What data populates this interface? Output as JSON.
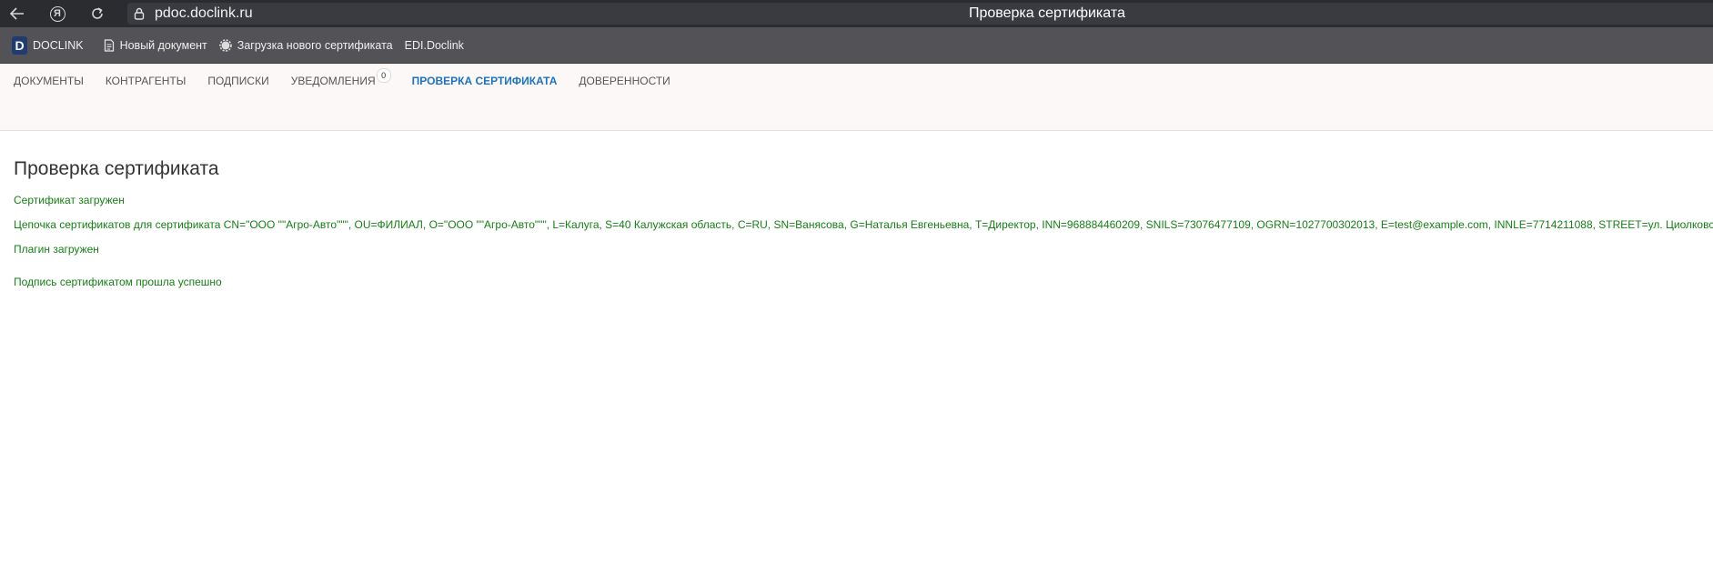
{
  "browser": {
    "url": "pdoc.doclink.ru",
    "page_title": "Проверка сертификата",
    "icons": [
      "back-arrow-icon",
      "yandex-icon",
      "reload-icon",
      "lock-icon"
    ]
  },
  "bookmarks": {
    "brand_letter": "D",
    "brand": "DOCLINK",
    "new_doc": "Новый документ",
    "upload_cert": "Загрузка нового сертификата",
    "edi": "EDI.Doclink"
  },
  "nav": {
    "documents": "ДОКУМЕНТЫ",
    "contractors": "КОНТРАГЕНТЫ",
    "subscriptions": "ПОДПИСКИ",
    "notifications": "УВЕДОМЛЕНИЯ",
    "notifications_count": "0",
    "check_cert": "ПРОВЕРКА СЕРТИФИКАТА",
    "powers": "ДОВЕРЕННОСТИ",
    "active_color": "#1e73be"
  },
  "content": {
    "title": "Проверка сертификата",
    "status_color": "#158015",
    "messages": {
      "loaded": "Сертификат загружен",
      "chain": "Цепочка сертификатов для сертификата CN=\"ООО \"\"Агро-Авто\"\"\", OU=ФИЛИАЛ, O=\"ООО \"\"Агро-Авто\"\"\", L=Калуга, S=40 Калужская область, C=RU, SN=Ванясова, G=Наталья Евгеньевна, T=Директор, INN=968884460209, SNILS=73076477109, OGRN=1027700302013, E=test@example.com, INNLE=7714211088, STREET=ул. Циолковского",
      "plugin": "Плагин загружен",
      "signed": "Подпись сертификатом прошла успешно"
    }
  }
}
